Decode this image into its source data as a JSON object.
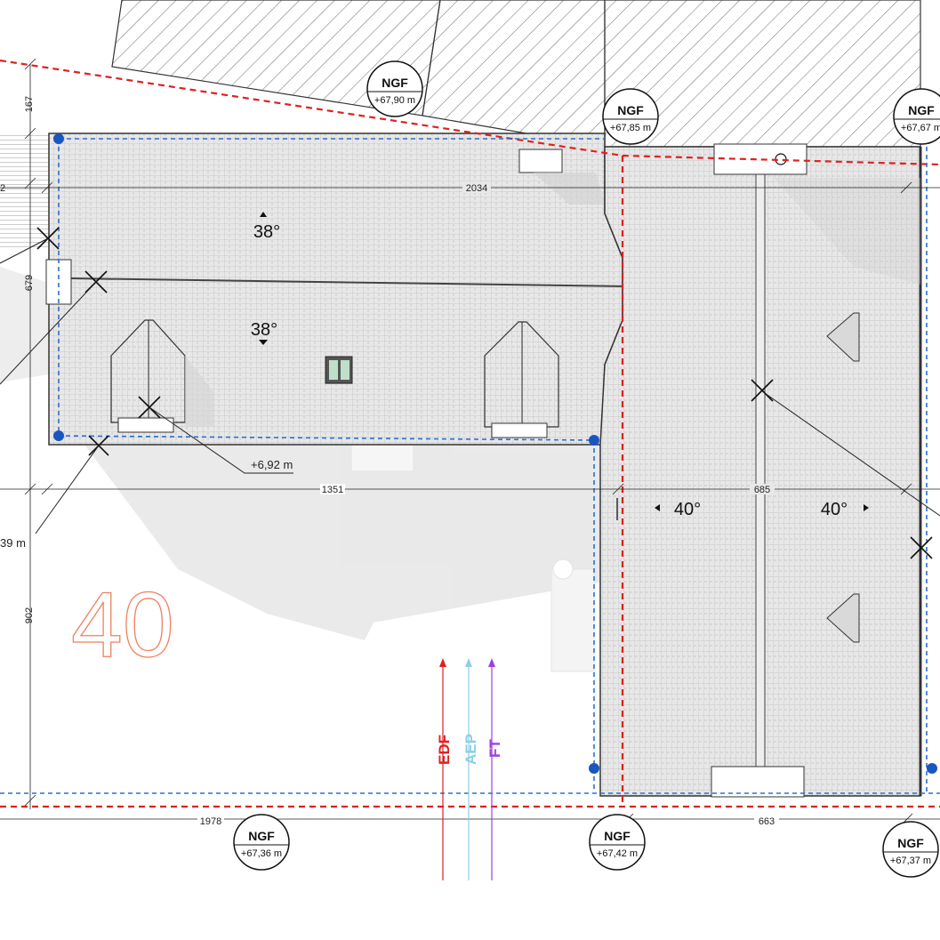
{
  "parcel_number": "40",
  "ngf_markers": [
    {
      "title": "NGF",
      "value": "+67,90 m"
    },
    {
      "title": "NGF",
      "value": "+67,85 m"
    },
    {
      "title": "NGF",
      "value": "+67,67 m"
    },
    {
      "title": "NGF",
      "value": "+67,36 m"
    },
    {
      "title": "NGF",
      "value": "+67,42 m"
    },
    {
      "title": "NGF",
      "value": "+67,37 m"
    }
  ],
  "dimensions": {
    "d167": "167",
    "d2034": "2034",
    "d679": "679",
    "d1351": "1351",
    "d685": "685",
    "d902": "902",
    "d1978": "1978",
    "d663": "663",
    "d2": "2"
  },
  "slopes": {
    "upper": "38°",
    "lower": "38°",
    "left": "40°",
    "right": "40°"
  },
  "elevations": {
    "ridge": "+6,92 m",
    "partial": "39 m"
  },
  "networks": [
    {
      "label": "EDF",
      "color": "#e02020"
    },
    {
      "label": "AEP",
      "color": "#8ccfe8"
    },
    {
      "label": "FT",
      "color": "#a040e0"
    }
  ],
  "colors": {
    "limit_red": "#e02020",
    "limit_blue": "#2a6fd0",
    "parcel_orange": "#f08060",
    "roof_fill": "#e6e6e6"
  }
}
